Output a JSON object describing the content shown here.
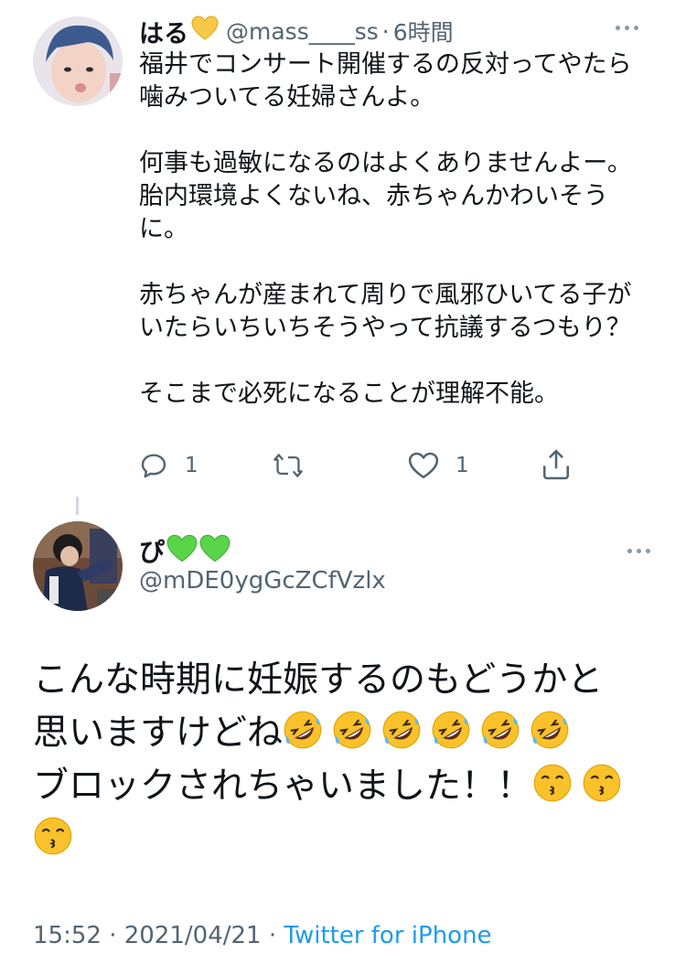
{
  "tweet1": {
    "display_name": "はる",
    "name_emoji": "💛",
    "handle": "@mass____ss",
    "separator": "·",
    "time": "6時間",
    "body": "福井でコンサート開催するの反対ってやたら\n噛みついてる妊婦さんよ。\n\n何事も過敏になるのはよくありませんよー。\n胎内環境よくないね、赤ちゃんかわいそう\nに。\n\n赤ちゃんが産まれて周りで風邪ひいてる子が\nいたらいちいちそうやって抗議するつもり？\n\nそこまで必死になることが理解不能。",
    "actions": {
      "reply_icon": "reply-icon",
      "reply_count": "1",
      "retweet_icon": "retweet-icon",
      "retweet_count": "",
      "like_icon": "heart-icon",
      "like_count": "1",
      "share_icon": "share-icon"
    }
  },
  "tweet2": {
    "display_name": "ぴ",
    "name_emojis": [
      "💚",
      "💚"
    ],
    "handle": "@mDE0ygGcZCfVzlx",
    "body_line1": "こんな時期に妊娠するのもどうかと",
    "body_line2": "思いますけどね",
    "body_line3": "ブロックされちゃいました！！",
    "emoji_line2": "rolling-on-floor-laughing x6",
    "emoji_line3": "kissing-face x3",
    "timestamp": "15:52 · 2021/04/21 · ",
    "source": "Twitter for iPhone"
  },
  "colors": {
    "text": "#0f1419",
    "secondary": "#536471",
    "link": "#1d9bf0",
    "icon": "#536471",
    "heart_emoji_yellow": "#f7c948",
    "heart_emoji_green": "#5ad449"
  }
}
